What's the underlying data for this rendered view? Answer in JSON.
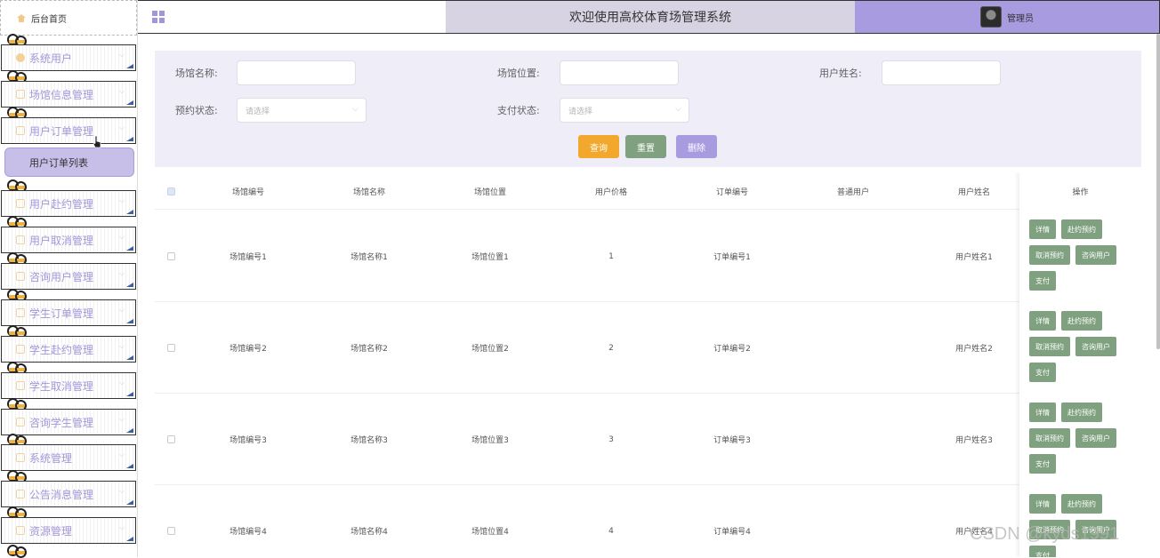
{
  "sidebar": {
    "home": "后台首页",
    "items": [
      {
        "label": "系统用户",
        "icon": "user-icon"
      },
      {
        "label": "场馆信息管理",
        "icon": "doc-icon"
      },
      {
        "label": "用户订单管理",
        "icon": "doc-icon"
      },
      {
        "label": "用户赴约管理",
        "icon": "doc-icon"
      },
      {
        "label": "用户取消管理",
        "icon": "doc-icon"
      },
      {
        "label": "咨询用户管理",
        "icon": "doc-icon"
      },
      {
        "label": "学生订单管理",
        "icon": "doc-icon"
      },
      {
        "label": "学生赴约管理",
        "icon": "doc-icon"
      },
      {
        "label": "学生取消管理",
        "icon": "doc-icon"
      },
      {
        "label": "咨询学生管理",
        "icon": "doc-icon"
      },
      {
        "label": "系统管理",
        "icon": "settings-icon"
      },
      {
        "label": "公告消息管理",
        "icon": "info-icon"
      },
      {
        "label": "资源管理",
        "icon": "resource-icon"
      }
    ],
    "submenu": "用户订单列表"
  },
  "header": {
    "title": "欢迎使用高校体育场管理系统",
    "user": "管理员"
  },
  "search": {
    "venue_name_label": "场馆名称:",
    "venue_location_label": "场馆位置:",
    "user_name_label": "用户姓名:",
    "booking_status_label": "预约状态:",
    "booking_status_placeholder": "请选择",
    "payment_status_label": "支付状态:",
    "payment_status_placeholder": "请选择",
    "query_button": "查询",
    "reset_button": "重置",
    "delete_button": "删除"
  },
  "table": {
    "columns": [
      "场馆编号",
      "场馆名称",
      "场馆位置",
      "用户价格",
      "订单编号",
      "普通用户",
      "用户姓名",
      "操作"
    ],
    "rows": [
      {
        "venue_no": "场馆编号1",
        "venue_name": "场馆名称1",
        "venue_location": "场馆位置1",
        "price": "1",
        "order_no": "订单编号1",
        "regular_user": "",
        "user_name": "用户姓名1"
      },
      {
        "venue_no": "场馆编号2",
        "venue_name": "场馆名称2",
        "venue_location": "场馆位置2",
        "price": "2",
        "order_no": "订单编号2",
        "regular_user": "",
        "user_name": "用户姓名2"
      },
      {
        "venue_no": "场馆编号3",
        "venue_name": "场馆名称3",
        "venue_location": "场馆位置3",
        "price": "3",
        "order_no": "订单编号3",
        "regular_user": "",
        "user_name": "用户姓名3"
      },
      {
        "venue_no": "场馆编号4",
        "venue_name": "场馆名称4",
        "venue_location": "场馆位置4",
        "price": "4",
        "order_no": "订单编号4",
        "regular_user": "",
        "user_name": "用户姓名4"
      }
    ],
    "actions": {
      "detail": "详情",
      "attend": "赴约预约",
      "cancel": "取消预约",
      "consult": "咨询用户",
      "pay": "支付"
    }
  },
  "watermark": "CSDN @kyds1991",
  "colors": {
    "accent": "#a99be0",
    "query": "#f1a82c",
    "green": "#7fa17f",
    "title_bg": "#d8d3e2",
    "panel_bg": "#efedf7"
  }
}
